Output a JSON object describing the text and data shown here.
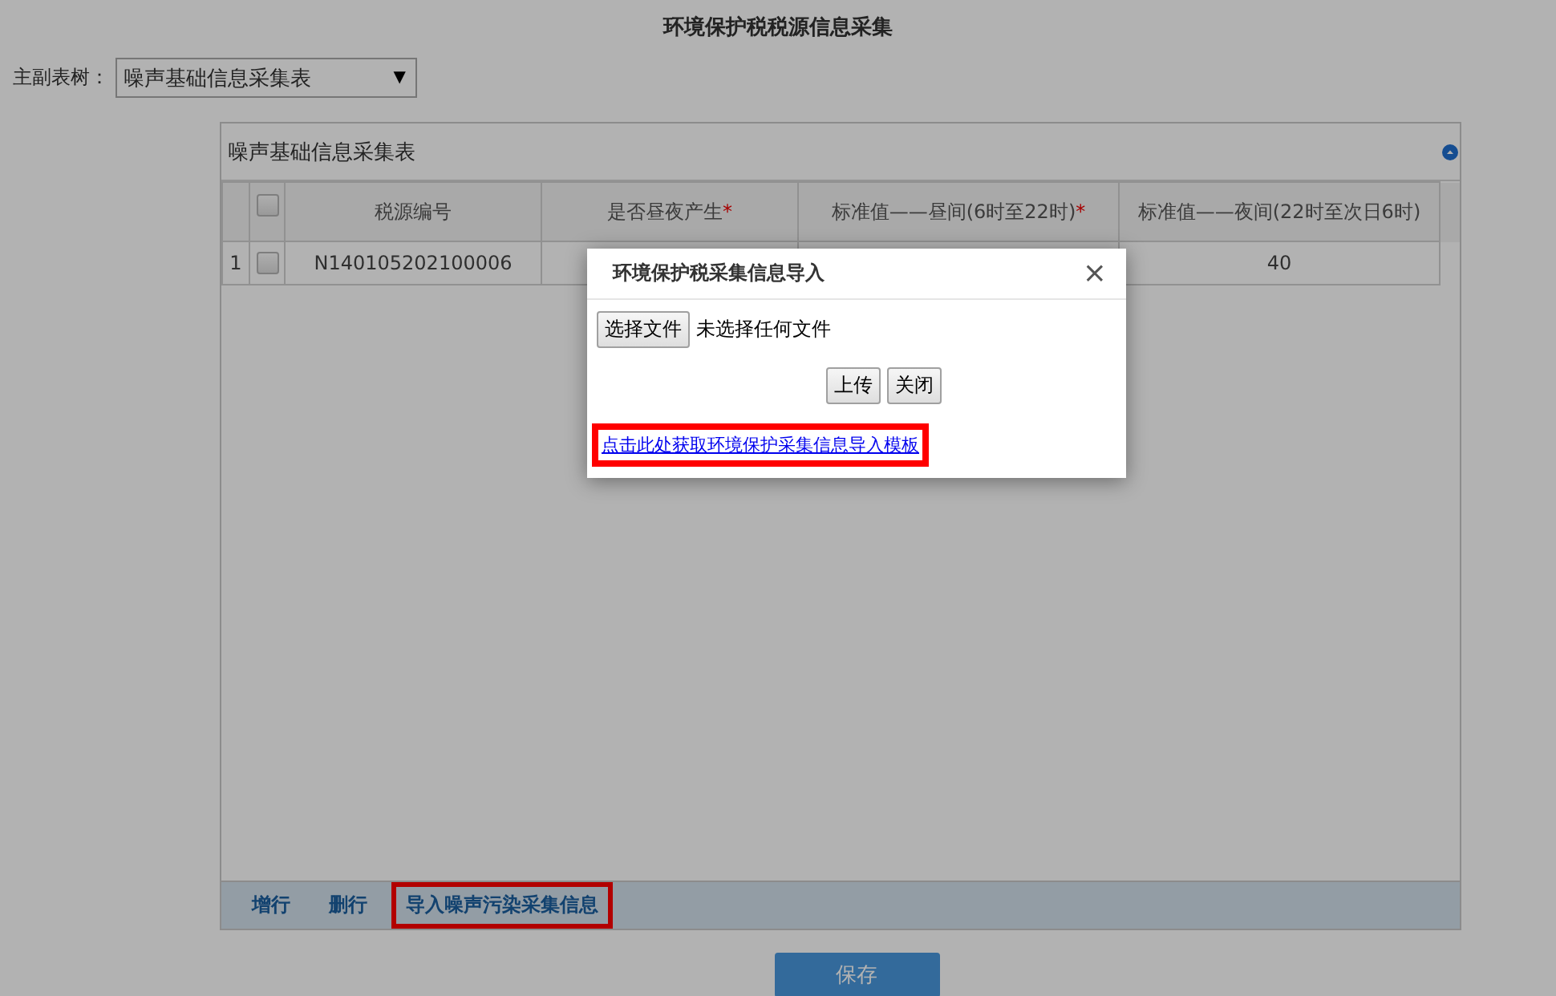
{
  "page_title": "环境保护税税源信息采集",
  "tree_select": {
    "label": "主副表树：",
    "value": "噪声基础信息采集表",
    "caret": "▼"
  },
  "panel": {
    "title": "噪声基础信息采集表",
    "collapsed": false,
    "table": {
      "columns": [
        {
          "label": "税源编号"
        },
        {
          "label": "是否昼夜产生",
          "required_mark": "*"
        },
        {
          "label": "标准值——昼间(6时至22时)",
          "required_mark": "*"
        },
        {
          "label": "标准值——夜间(22时至次日6时)"
        }
      ],
      "header_checked": false,
      "rows": [
        {
          "index": "1",
          "checked": false,
          "cells": [
            "N140105202100006",
            "",
            "",
            "40"
          ]
        }
      ]
    },
    "actions": [
      {
        "label": "增行",
        "highlighted": false
      },
      {
        "label": "删行",
        "highlighted": false
      },
      {
        "label": "导入噪声污染采集信息",
        "highlighted": true
      }
    ]
  },
  "save_button": "保存",
  "dialog": {
    "title": "环境保护税采集信息导入",
    "close": "×",
    "file_button": "选择文件",
    "file_status": "未选择任何文件",
    "buttons": [
      "上传",
      "关闭"
    ],
    "template_link": {
      "text": "点击此处获取环境保护采集信息导入模板",
      "highlighted": true
    }
  }
}
